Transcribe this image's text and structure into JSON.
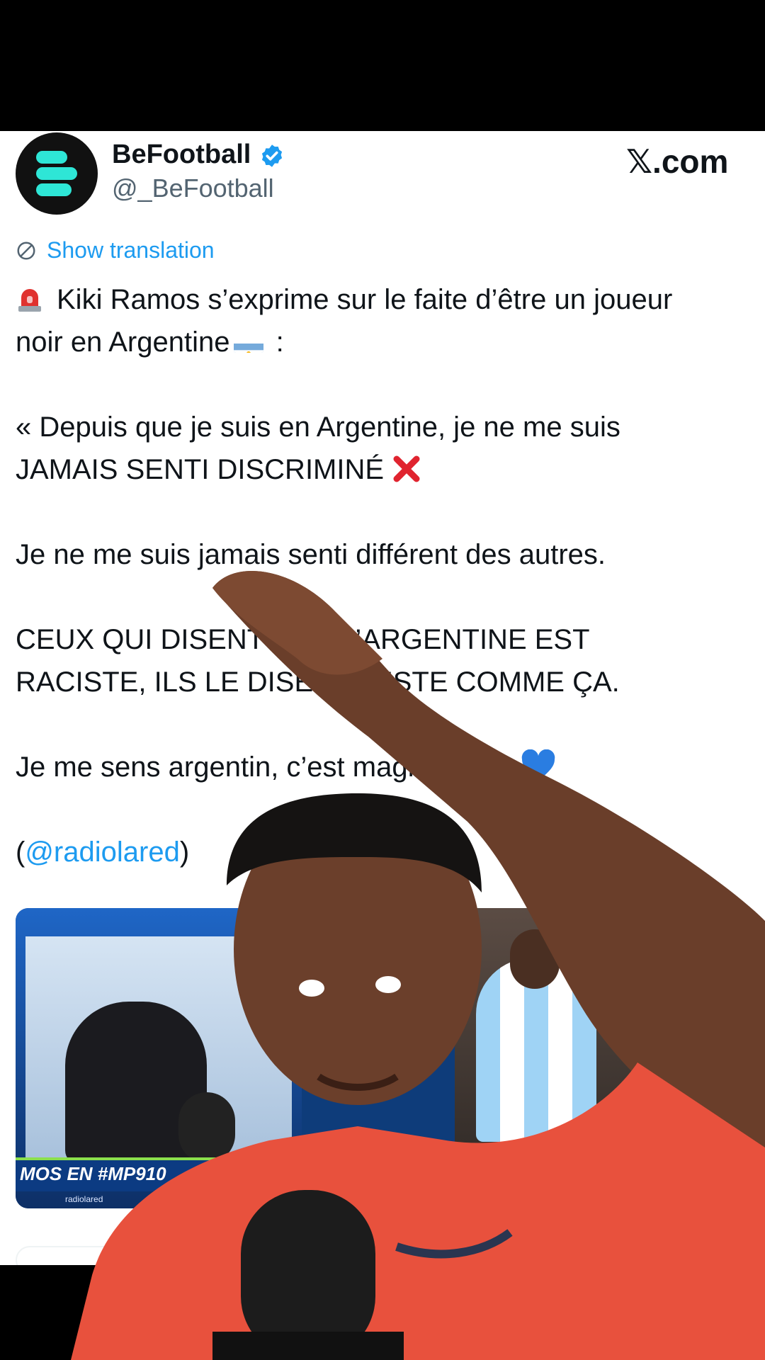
{
  "account": {
    "display_name": "BeFootball",
    "handle": "@_BeFootball",
    "verified": true
  },
  "platform": {
    "logo_text": "𝕏.com"
  },
  "translate": {
    "label": "Show translation"
  },
  "tweet": {
    "line1": "Kiki Ramos s’exprime sur le faite d’être un joueur",
    "line2a": "noir en Argentine",
    "line2b": " :",
    "line3": "« Depuis que je suis en Argentine, je ne me suis",
    "line4": "JAMAIS SENTI DISCRIMINÉ",
    "line5": "Je ne me suis jamais senti différent des autres.",
    "line6": "CEUX QUI DISENT QUE L’ARGENTINE EST",
    "line7": "RACISTE, ILS LE DISENT JUSTE COMME ÇA.",
    "line8": "Je me sens argentin, c’est magnifique »",
    "credit_open": "(",
    "credit_mention": "@radiolared",
    "credit_close": ")"
  },
  "media": {
    "ticker_text": "MOS EN #MP910",
    "ticker_sub": "radiolared"
  },
  "icons": {
    "siren": "police-light-icon",
    "flag": "argentina-flag-icon",
    "cross": "cross-mark-icon",
    "heart": "blue-heart-icon",
    "verified": "verified-badge-icon",
    "translate": "globe-translate-icon"
  },
  "colors": {
    "link": "#1d9bf0",
    "text": "#0f1419",
    "muted": "#536471",
    "brand_teal": "#2ee6d6",
    "verified_blue": "#1d9bf0",
    "shirt": "#e8513d"
  }
}
